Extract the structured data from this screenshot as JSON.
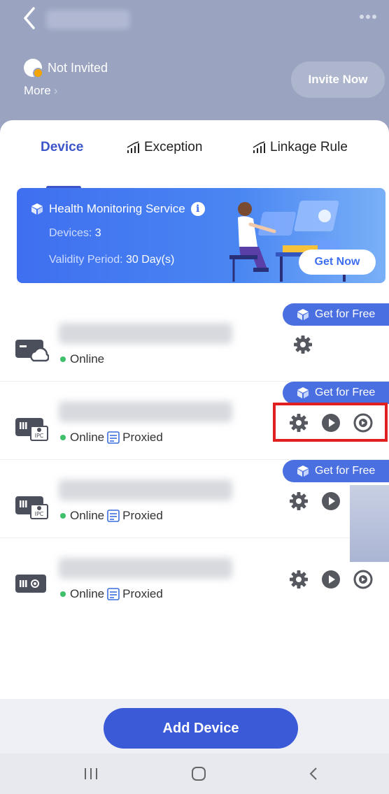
{
  "header": {
    "status_text": "Not Invited",
    "more_label": "More",
    "invite_label": "Invite Now"
  },
  "tabs": [
    {
      "label": "Device",
      "active": true
    },
    {
      "label": "Exception",
      "active": false
    },
    {
      "label": "Linkage Rule",
      "active": false
    }
  ],
  "banner": {
    "title": "Health Monitoring Service",
    "devices_label": "Devices: ",
    "devices_value": "3",
    "validity_label": "Validity Period: ",
    "validity_value": "30 Day(s)",
    "cta_label": "Get Now"
  },
  "devices": [
    {
      "tag": "Get for Free",
      "status": "Online",
      "proxied": "",
      "icon": "cloud-nvr-icon",
      "actions": [
        "settings"
      ]
    },
    {
      "tag": "Get for Free",
      "status": "Online",
      "proxied": "Proxied",
      "icon": "ipc-nvr-icon",
      "actions": [
        "settings",
        "play",
        "playback"
      ]
    },
    {
      "tag": "Get for Free",
      "status": "Online",
      "proxied": "Proxied",
      "icon": "ipc-nvr-icon",
      "actions": [
        "settings",
        "play",
        "playback"
      ]
    },
    {
      "tag": "",
      "status": "Online",
      "proxied": "Proxied",
      "icon": "nvr-icon",
      "actions": [
        "settings",
        "play",
        "playback"
      ]
    }
  ],
  "footer": {
    "add_device_label": "Add Device"
  },
  "colors": {
    "accent": "#3c55c8",
    "header_bg": "#9aa3bf",
    "online_dot": "#3ec06a",
    "highlight_box": "#e02020"
  }
}
